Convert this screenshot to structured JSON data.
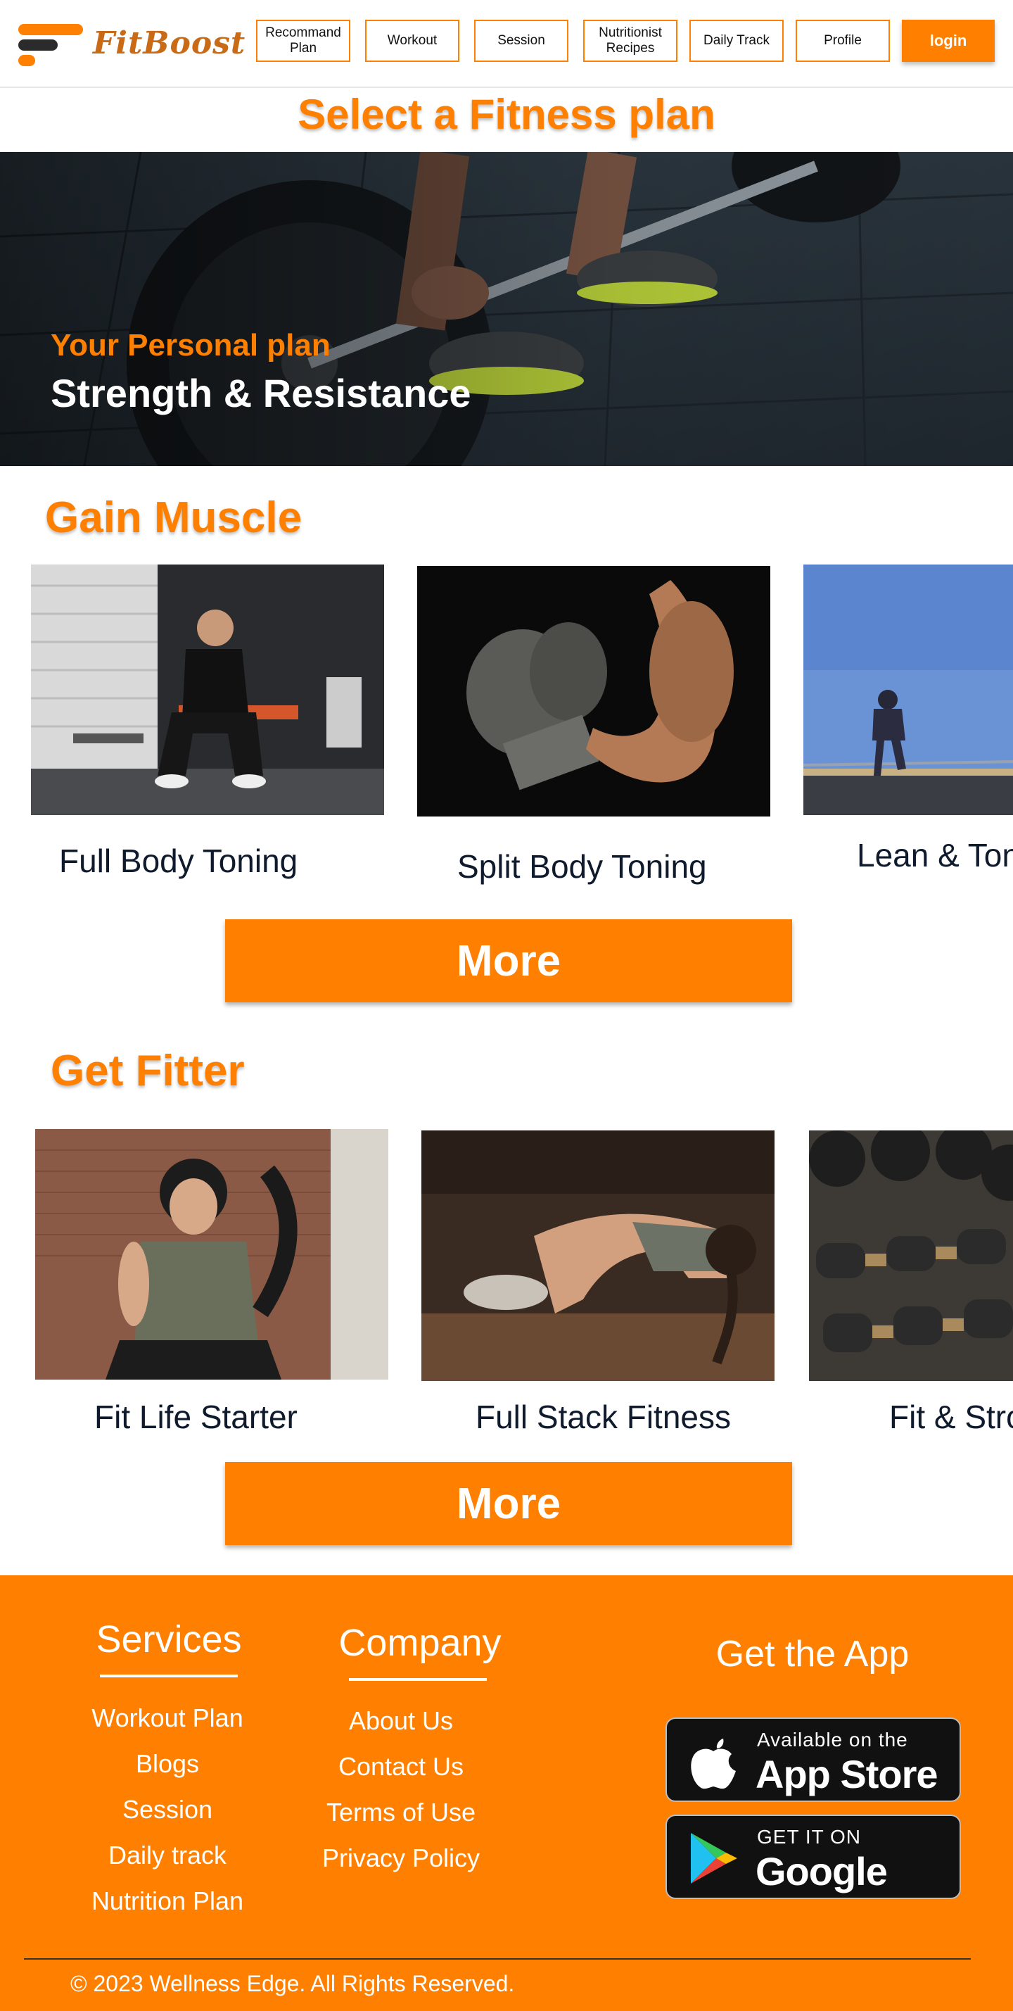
{
  "brand": {
    "name": "FitBoost"
  },
  "nav": {
    "items": [
      {
        "label": "Recommand\nPlan"
      },
      {
        "label": "Workout"
      },
      {
        "label": "Session"
      },
      {
        "label": "Nutritionist\nRecipes"
      },
      {
        "label": "Daily Track"
      },
      {
        "label": "Profile"
      }
    ],
    "login_label": "login"
  },
  "page_title": "Select a Fitness plan",
  "hero": {
    "subtitle": "Your Personal plan",
    "title": "Strength & Resistance"
  },
  "sections": [
    {
      "title": "Gain Muscle",
      "cards": [
        {
          "label": "Full Body Toning"
        },
        {
          "label": "Split Body Toning"
        },
        {
          "label": "Lean & Toned"
        }
      ],
      "more_label": "More"
    },
    {
      "title": "Get Fitter",
      "cards": [
        {
          "label": "Fit Life Starter"
        },
        {
          "label": "Full Stack Fitness"
        },
        {
          "label": "Fit & Strong"
        }
      ],
      "more_label": "More"
    }
  ],
  "footer": {
    "services": {
      "title": "Services",
      "links": [
        "Workout Plan",
        "Blogs",
        "Session",
        "Daily track",
        "Nutrition Plan"
      ]
    },
    "company": {
      "title": "Company",
      "links": [
        "About Us",
        "Contact Us",
        "Terms of Use",
        "Privacy Policy"
      ]
    },
    "app": {
      "title": "Get the App",
      "app_store": {
        "small": "Available on the",
        "big": "App Store"
      },
      "google_play": {
        "small": "GET IT ON",
        "big": "Google Play"
      }
    },
    "copyright": "© 2023 Wellness Edge. All Rights Reserved."
  },
  "colors": {
    "accent": "#ff7f00",
    "text_dark": "#0f1b2d",
    "logo_text": "#c96a16"
  }
}
